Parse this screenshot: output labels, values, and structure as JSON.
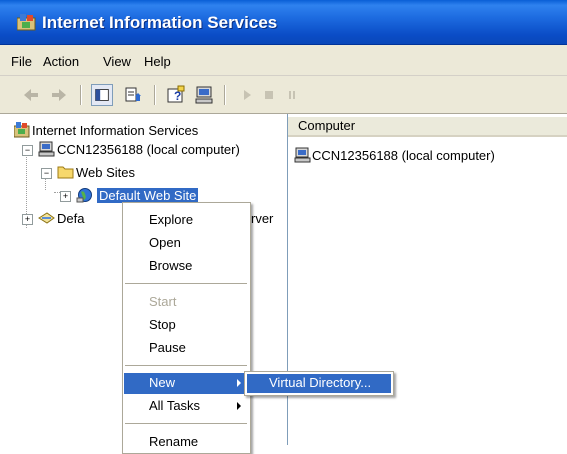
{
  "window": {
    "title": "Internet Information Services",
    "icon": "iis-icon"
  },
  "menubar": {
    "items": [
      "File",
      "Action",
      "View",
      "Help"
    ]
  },
  "toolbar": {
    "buttons": [
      "back-arrow-icon",
      "forward-arrow-icon",
      "show-hide-tree-icon",
      "export-list-icon",
      "help-icon",
      "computer-icon",
      "play-icon",
      "stop-icon",
      "pause-icon"
    ]
  },
  "tree": {
    "root": "Internet Information Services",
    "computer": "CCN12356188 (local computer)",
    "web_sites": "Web Sites",
    "default_web_site": "Default Web Site",
    "default_smtp_partial": "Defa",
    "default_smtp_tail": "rver"
  },
  "list": {
    "column_header": "Computer",
    "rows": [
      "CCN12356188 (local computer)"
    ]
  },
  "context_menu": {
    "items": [
      "Explore",
      "Open",
      "Browse",
      "Start",
      "Stop",
      "Pause",
      "New",
      "All Tasks",
      "Rename"
    ],
    "disabled": [
      "Start"
    ],
    "highlighted": "New"
  },
  "submenu": {
    "items": [
      "Virtual Directory..."
    ]
  },
  "colors": {
    "title_bar": "#0a4cc6",
    "selection": "#316ac5",
    "menu_bg": "#ece9d8"
  }
}
